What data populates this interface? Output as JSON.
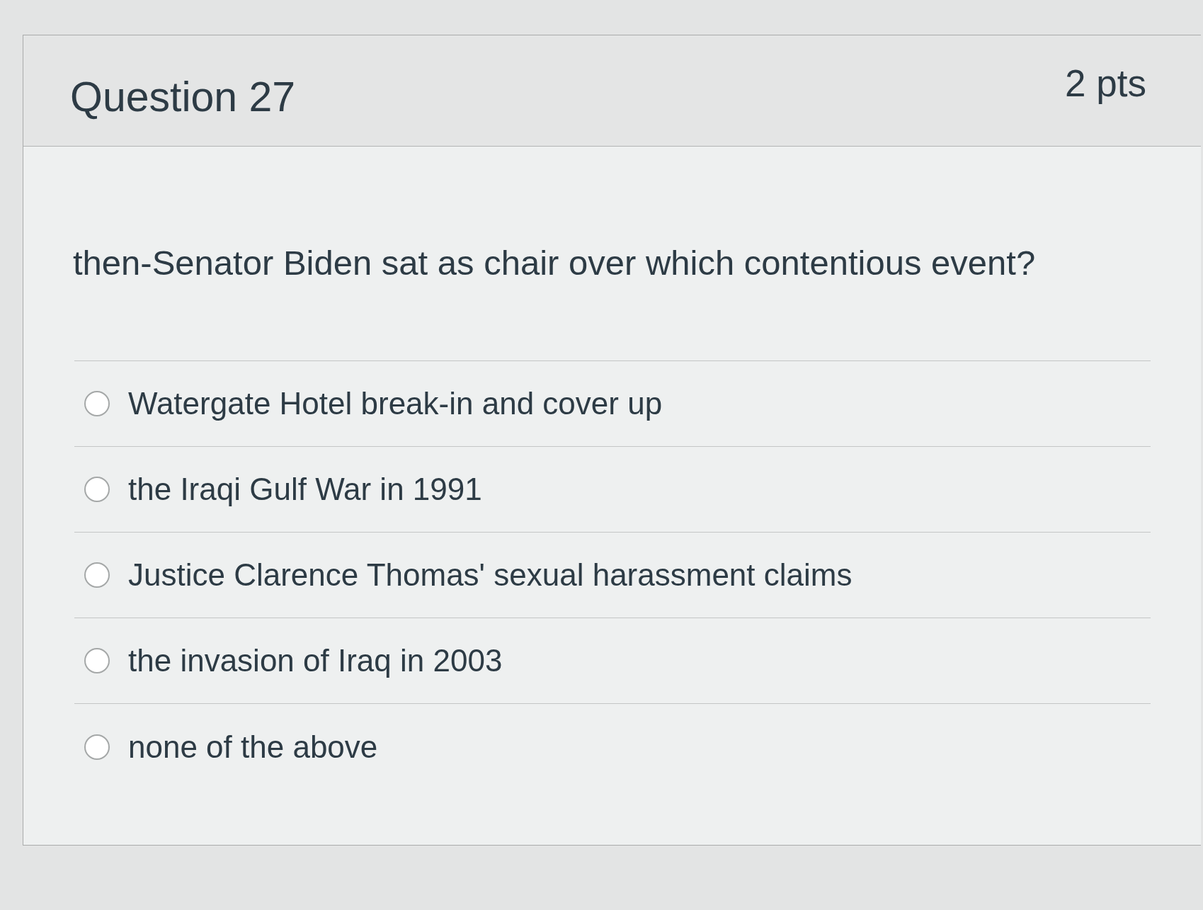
{
  "question": {
    "title": "Question 27",
    "points": "2 pts",
    "text": "then-Senator Biden sat as chair over which contentious event?"
  },
  "answers": [
    {
      "label": "Watergate Hotel break-in and cover up",
      "selected": false
    },
    {
      "label": "the Iraqi Gulf War in 1991",
      "selected": false
    },
    {
      "label": "Justice Clarence Thomas' sexual harassment claims",
      "selected": false
    },
    {
      "label": "the invasion of Iraq in 2003",
      "selected": false
    },
    {
      "label": "none of the above",
      "selected": false
    }
  ]
}
